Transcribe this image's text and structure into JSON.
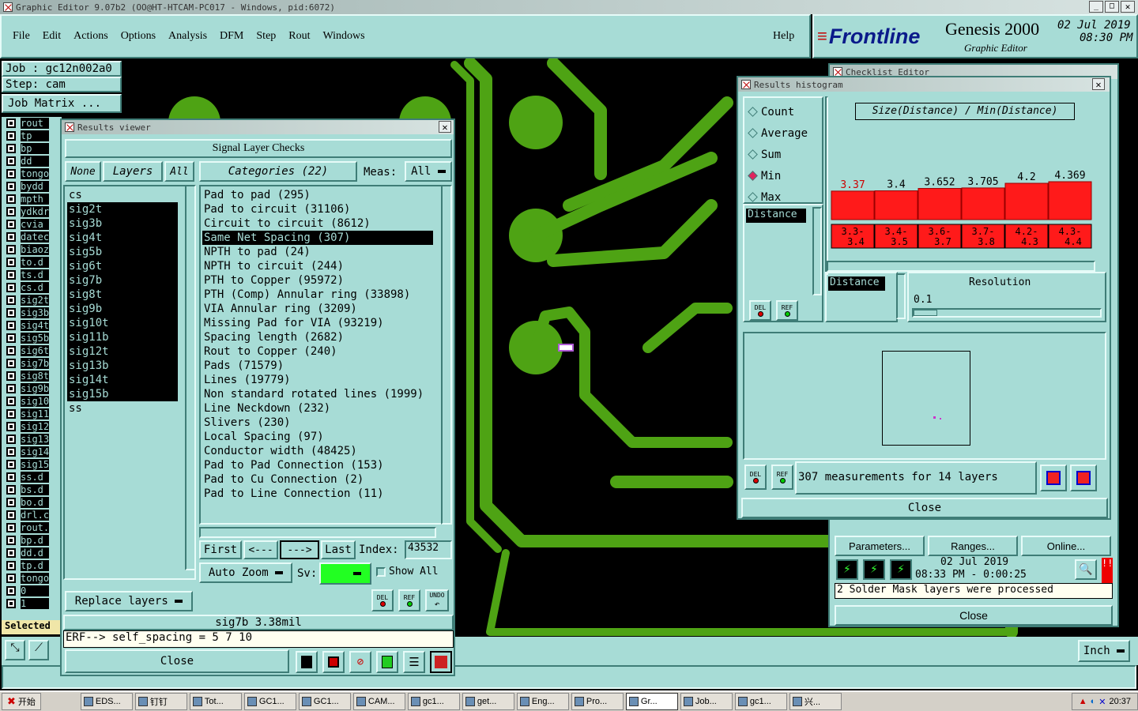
{
  "app": {
    "title": "Graphic Editor 9.07b2 (OO@HT-HTCAM-PC017 - Windows, pid:6072)",
    "brand": "Frontline",
    "product": "Genesis 2000",
    "subtitle": "Graphic Editor",
    "date": "02 Jul 2019",
    "time": "08:30 PM"
  },
  "menu": [
    "File",
    "Edit",
    "Actions",
    "Options",
    "Analysis",
    "DFM",
    "Step",
    "Rout",
    "Windows"
  ],
  "help_label": "Help",
  "job": {
    "job_label": "Job : gc12n002a0",
    "step_label": "Step: cam",
    "matrix_button": "Job Matrix ..."
  },
  "layer_list": [
    "rout",
    "tp",
    "bp",
    "dd",
    "tongo",
    "bydd",
    "mpth",
    "ydkdr",
    "cvia",
    "datec",
    "biaoz",
    "to.d",
    "ts.d",
    "cs.d",
    "sig2t",
    "sig3b",
    "sig4t",
    "sig5b",
    "sig6t",
    "sig7b",
    "sig8t",
    "sig9b",
    "sig10",
    "sig11",
    "sig12",
    "sig13",
    "sig14",
    "sig15",
    "ss.d",
    "bs.d",
    "bo.d",
    "drl.c",
    "rout.",
    "bp.d",
    "dd.d",
    "tp.d",
    "tongo",
    "0",
    "1"
  ],
  "selected_label": "Selected :",
  "results_viewer": {
    "title": "Results viewer",
    "header": "Signal Layer Checks",
    "none_button": "None",
    "layers_button": "Layers",
    "all_button": "All",
    "categories_button": "Categories (22)",
    "meas_label": "Meas:",
    "meas_value": "All",
    "layers": [
      "cs",
      "sig2t",
      "sig3b",
      "sig4t",
      "sig5b",
      "sig6t",
      "sig7b",
      "sig8t",
      "sig9b",
      "sig10t",
      "sig11b",
      "sig12t",
      "sig13b",
      "sig14t",
      "sig15b",
      "ss"
    ],
    "categories": [
      "Pad to pad (295)",
      "Pad to circuit (31106)",
      "Circuit to circuit (8612)",
      "Same Net Spacing (307)",
      "NPTH to pad (24)",
      "NPTH to circuit (244)",
      "PTH to Copper (95972)",
      "PTH (Comp) Annular ring (33898)",
      "VIA Annular ring (3209)",
      "Missing Pad for VIA (93219)",
      "Spacing length (2682)",
      "Rout to Copper (240)",
      "Pads (71579)",
      "Lines (19779)",
      "Non standard rotated lines (1999)",
      "Line Neckdown (232)",
      "Slivers (230)",
      "Local Spacing (97)",
      "Conductor width (48425)",
      "Pad to Pad Connection (153)",
      "Pad to Cu Connection (2)",
      "Pad to Line Connection (11)"
    ],
    "selected_category": "Same Net Spacing (307)",
    "nav": {
      "first": "First",
      "prev": "<---",
      "next": "--->",
      "last": "Last",
      "index_label": "Index:",
      "index_value": "43532"
    },
    "auto_zoom": "Auto Zoom",
    "sv_label": "Sv:",
    "show_all": "Show All",
    "replace_layers": "Replace layers",
    "del": "DEL",
    "ref": "REF",
    "undo": "UNDO",
    "status": "sig7b 3.38mil",
    "erf": "ERF--> self_spacing = 5 7 10",
    "close": "Close"
  },
  "histogram": {
    "title": "Results histogram",
    "modes": [
      "Count",
      "Average",
      "Sum",
      "Min",
      "Max"
    ],
    "selected_mode": "Min",
    "chart_title": "Size(Distance) / Min(Distance)",
    "list_item": "Distance",
    "bar_values": [
      "3.37",
      "3.4",
      "3.652",
      "3.705",
      "4.2",
      "4.369"
    ],
    "bin_labels": [
      [
        "3.3-",
        "3.4"
      ],
      [
        "3.4-",
        "3.5"
      ],
      [
        "3.6-",
        "3.7"
      ],
      [
        "3.7-",
        "3.8"
      ],
      [
        "4.2-",
        "4.3"
      ],
      [
        "4.3-",
        "4.4"
      ]
    ],
    "resolution_label": "Resolution",
    "resolution_value": "0.1",
    "distance_label": "Distance",
    "measurements": "307 measurements for 14 layers",
    "del": "DEL",
    "ref": "REF",
    "close": "Close",
    "bar_color": "#ff1a1a",
    "first_value_color": "#cc0000"
  },
  "checklist": {
    "title": "Checklist Editor",
    "buttons": [
      "Parameters...",
      "Ranges...",
      "Online..."
    ],
    "date": "02 Jul 2019",
    "time": "08:33 PM - 0:00:25",
    "message": "2 Solder Mask layers were processed",
    "close": "Close"
  },
  "units_button": "Inch",
  "taskbar": {
    "start": "开始",
    "items": [
      "EDS...",
      "钉钉",
      "Tot...",
      "GC1...",
      "GC1...",
      "CAM...",
      "gc1...",
      "get...",
      "Eng...",
      "Pro...",
      "Gr...",
      "Job...",
      "gc1...",
      "兴..."
    ],
    "active": "Gr...",
    "clock": "20:37"
  },
  "colors": {
    "panel": "#a7dcd6",
    "copper": "#4ea314",
    "canvas": "#000000"
  }
}
